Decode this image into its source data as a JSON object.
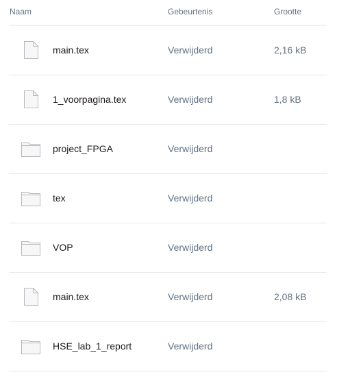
{
  "columns": {
    "name": "Naam",
    "event": "Gebeurtenis",
    "size": "Grootte"
  },
  "rows": [
    {
      "icon": "file-icon",
      "name": "main.tex",
      "event": "Verwijderd",
      "size": "2,16 kB"
    },
    {
      "icon": "file-icon",
      "name": "1_voorpagina.tex",
      "event": "Verwijderd",
      "size": "1,8 kB"
    },
    {
      "icon": "folder-icon",
      "name": "project_FPGA",
      "event": "Verwijderd",
      "size": ""
    },
    {
      "icon": "folder-icon",
      "name": "tex",
      "event": "Verwijderd",
      "size": ""
    },
    {
      "icon": "folder-icon",
      "name": "VOP",
      "event": "Verwijderd",
      "size": ""
    },
    {
      "icon": "file-icon",
      "name": "main.tex",
      "event": "Verwijderd",
      "size": "2,08 kB"
    },
    {
      "icon": "folder-icon",
      "name": "HSE_lab_1_report",
      "event": "Verwijderd",
      "size": ""
    }
  ],
  "colors": {
    "icon_fill": "#f7f7f7",
    "icon_stroke": "#b5b9be",
    "divider": "#e6e8eb"
  }
}
